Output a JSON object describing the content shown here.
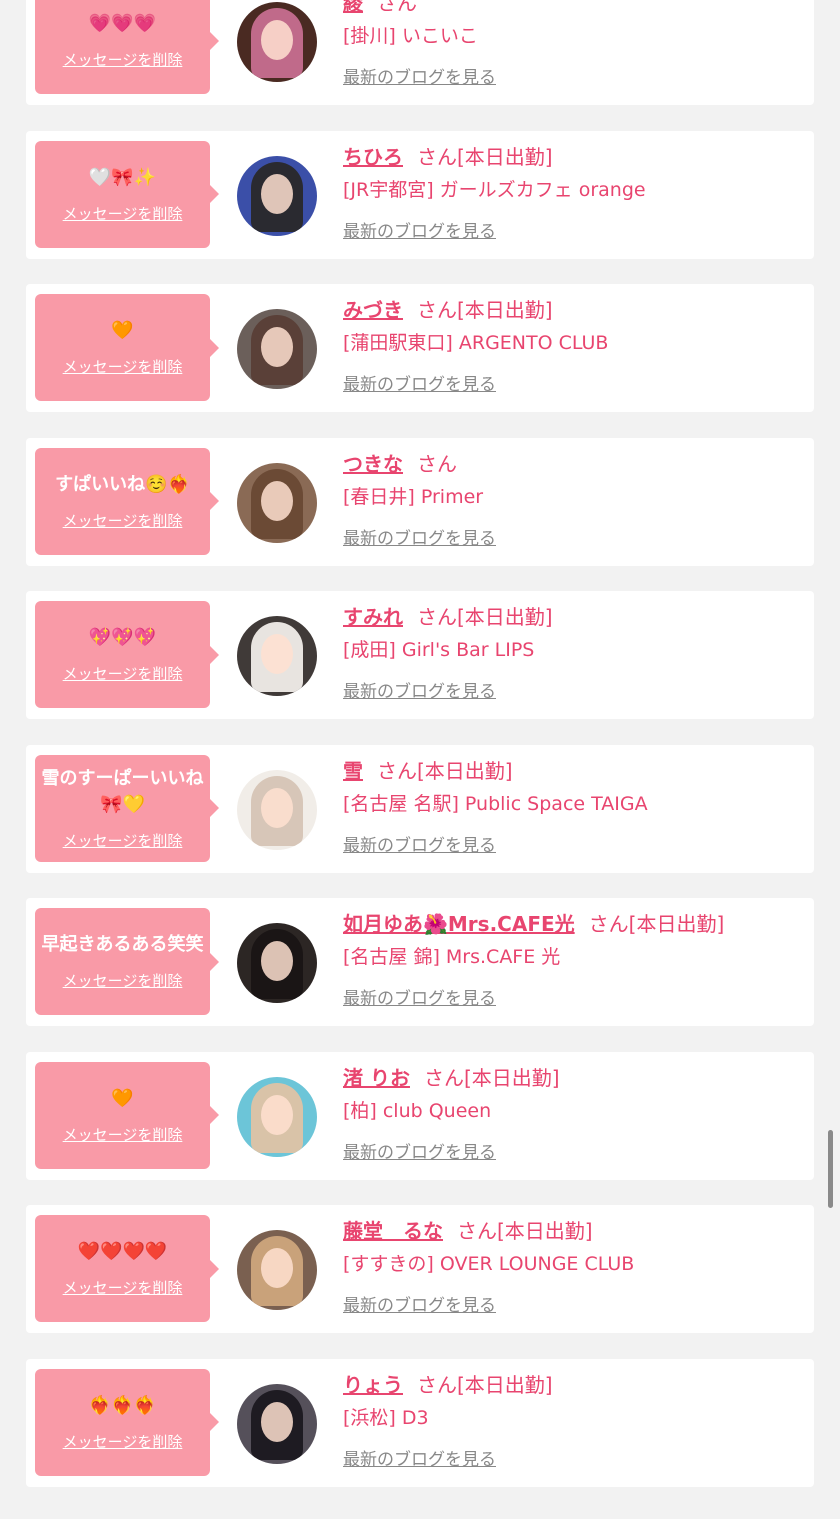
{
  "delete_label": "メッセージを削除",
  "blog_label": "最新のブログを見る",
  "san_label": "さん",
  "colors": {
    "accent": "#e8456f",
    "bubble": "#f99aa7",
    "background": "#f2f2f2"
  },
  "items": [
    {
      "message": "💗💗💗",
      "name": "綾",
      "status": "",
      "shop": "[掛川] いこいこ",
      "avatar_icon": "avatar-photo-icon",
      "avatar_bg": "#4a2a22",
      "avatar_hair": "#c06a8a"
    },
    {
      "message": "🤍🎀✨",
      "name": "ちひろ",
      "status": "[本日出勤]",
      "shop": "[JR宇都宮] ガールズカフェ orange",
      "avatar_icon": "avatar-photo-icon",
      "avatar_bg": "#3b4fa8",
      "avatar_hair": "#2a2a30"
    },
    {
      "message": "🧡",
      "name": "みづき",
      "status": "[本日出勤]",
      "shop": "[蒲田駅東口] ARGENTO CLUB",
      "avatar_icon": "avatar-photo-icon",
      "avatar_bg": "#6b5f5a",
      "avatar_hair": "#5a4038"
    },
    {
      "message": "すぱいいね☺️❤️‍🔥",
      "name": "つきな",
      "status": "",
      "shop": "[春日井] Primer",
      "avatar_icon": "avatar-photo-icon",
      "avatar_bg": "#8a6a55",
      "avatar_hair": "#6b4a35"
    },
    {
      "message": "💖💖💖",
      "name": "すみれ",
      "status": "[本日出勤]",
      "shop": "[成田] Girl's Bar LIPS",
      "avatar_icon": "avatar-photo-icon",
      "avatar_bg": "#403a38",
      "avatar_hair": "#e8e4e0"
    },
    {
      "message": "雪のすーぱーいいね🎀💛",
      "name": "雪",
      "status": "[本日出勤]",
      "shop": "[名古屋 名駅] Public Space TAIGA",
      "avatar_icon": "avatar-photo-icon",
      "avatar_bg": "#f1ede8",
      "avatar_hair": "#d7c6b8"
    },
    {
      "message": "早起きあるある笑笑",
      "name": "如月ゆあ🌺Mrs.CAFE光",
      "status": "[本日出勤]",
      "shop": "[名古屋 錦] Mrs.CAFE 光",
      "avatar_icon": "avatar-photo-icon",
      "avatar_bg": "#2c2624",
      "avatar_hair": "#1a1515"
    },
    {
      "message": "🧡",
      "name": "渚 りお",
      "status": "[本日出勤]",
      "shop": "[柏] club Queen",
      "avatar_icon": "avatar-photo-icon",
      "avatar_bg": "#6cc5d8",
      "avatar_hair": "#d9c3a8"
    },
    {
      "message": "❤️❤️❤️❤️",
      "name": "藤堂　るな",
      "status": "[本日出勤]",
      "shop": "[すすきの] OVER LOUNGE CLUB",
      "avatar_icon": "avatar-photo-icon",
      "avatar_bg": "#7a6050",
      "avatar_hair": "#c9a27a"
    },
    {
      "message": "❤️‍🔥❤️‍🔥❤️‍🔥",
      "name": "りょう",
      "status": "[本日出勤]",
      "shop": "[浜松] D3",
      "avatar_icon": "avatar-photo-icon",
      "avatar_bg": "#55505a",
      "avatar_hair": "#1e1b22"
    }
  ]
}
